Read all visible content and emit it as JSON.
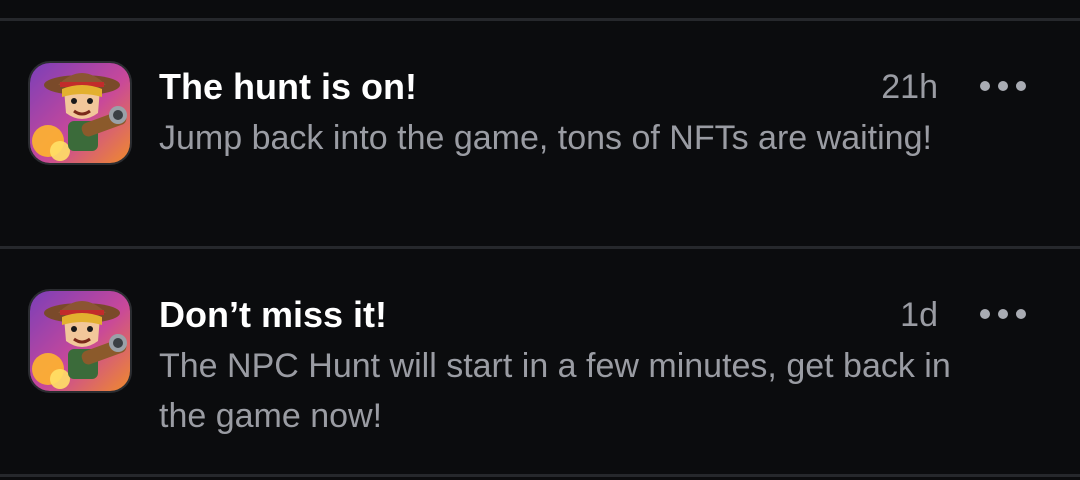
{
  "notifications": [
    {
      "icon": "npc-hunt-app-icon",
      "title": "The hunt is on!",
      "time": "21h",
      "body": "Jump back into the game, tons of NFTs are waiting!",
      "more_icon": "more-horizontal-icon"
    },
    {
      "icon": "npc-hunt-app-icon",
      "title": "Don’t miss it!",
      "time": "1d",
      "body": "The NPC Hunt will start in a few minutes, get back in the game now!",
      "more_icon": "more-horizontal-icon"
    }
  ],
  "colors": {
    "background": "#0b0c0e",
    "title": "#ffffff",
    "secondary_text": "#9a9ca3",
    "divider": "#26282c"
  }
}
